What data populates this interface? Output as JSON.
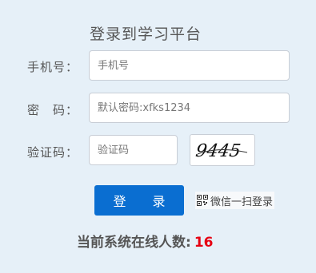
{
  "form": {
    "title": "登录到学习平台",
    "phone": {
      "label": "手机号：",
      "placeholder": "手机号"
    },
    "password": {
      "label": "密　码：",
      "placeholder": "默认密码:xfks1234"
    },
    "verify": {
      "label": "验证码：",
      "placeholder": "验证码",
      "captcha_text": "9445"
    },
    "login_label": "登 录",
    "wechat_label": "微信一扫登录"
  },
  "online": {
    "label": "当前系统在线人数:",
    "count": "16"
  },
  "colors": {
    "accent": "#0a6ed1",
    "count": "#e60012",
    "background": "#e6f0f8"
  }
}
